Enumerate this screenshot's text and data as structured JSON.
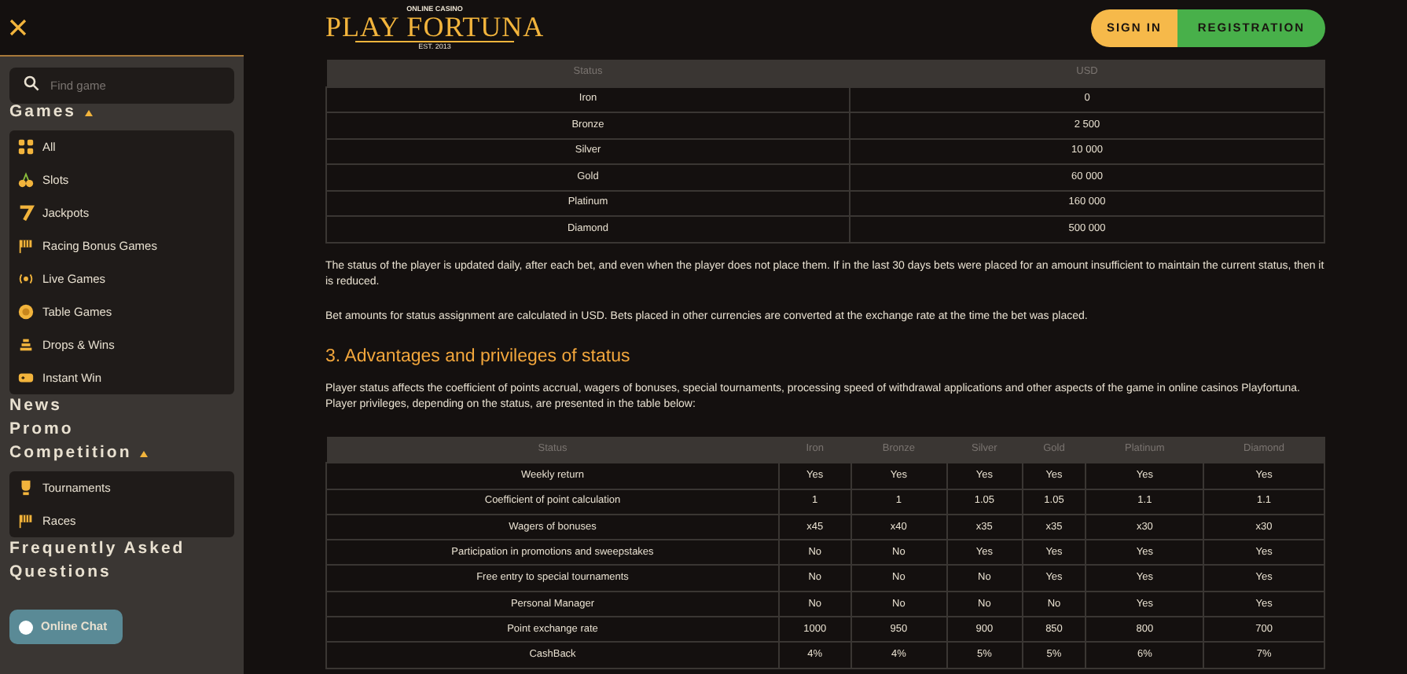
{
  "sidebar": {
    "search": {
      "placeholder": "Find game"
    },
    "sections": [
      {
        "label": "Games",
        "expanded": true,
        "items": [
          {
            "label": "All"
          },
          {
            "label": "Slots"
          },
          {
            "label": "Jackpots"
          },
          {
            "label": "Racing Bonus Games"
          },
          {
            "label": "Live Games"
          },
          {
            "label": "Table Games"
          },
          {
            "label": "Drops & Wins"
          },
          {
            "label": "Instant Win"
          }
        ]
      },
      {
        "label": "News"
      },
      {
        "label": "Promo"
      },
      {
        "label": "Competition",
        "expanded": true,
        "items": [
          {
            "label": "Tournaments"
          },
          {
            "label": "Races"
          }
        ]
      },
      {
        "label": "Frequently Asked Questions"
      }
    ],
    "chat_button": "Online Chat"
  },
  "header": {
    "logo": {
      "top": "ONLINE CASINO",
      "name": "PLAY FORTUNA",
      "bottom": "EST. 2013"
    },
    "buttons": [
      {
        "label": "SIGN IN",
        "kind": "signin"
      },
      {
        "label": "REGISTRATION",
        "kind": "register"
      }
    ]
  },
  "content": [
    {
      "kind": "table",
      "columns": [
        "Status",
        "USD"
      ],
      "rows": [
        [
          "Iron",
          "0"
        ],
        [
          "Bronze",
          "2 500"
        ],
        [
          "Silver",
          "10 000"
        ],
        [
          "Gold",
          "60 000"
        ],
        [
          "Platinum",
          "160 000"
        ],
        [
          "Diamond",
          "500 000"
        ]
      ]
    },
    {
      "kind": "paragraph",
      "text": "The status of the player is updated daily, after each bet, and even when the player does not place them. If in the last 30 days bets were placed for an amount insufficient to maintain the current status, then it is reduced."
    },
    {
      "kind": "paragraph",
      "text": "Bet amounts for status assignment are calculated in USD. Bets placed in other currencies are converted at the exchange rate at the time the bet was placed."
    },
    {
      "kind": "heading",
      "text": "3. Advantages and privileges of status"
    },
    {
      "kind": "paragraph",
      "text": "Player status affects the coefficient of points accrual, wagers of bonuses, special tournaments, processing speed of withdrawal applications and other aspects of the game in online casinos Playfortuna. Player privileges, depending on the status, are presented in the table below:"
    },
    {
      "kind": "table",
      "columns": [
        "Status",
        "Iron",
        "Bronze",
        "Silver",
        "Gold",
        "Platinum",
        "Diamond"
      ],
      "rows": [
        [
          "Weekly return",
          "Yes",
          "Yes",
          "Yes",
          "Yes",
          "Yes",
          "Yes"
        ],
        [
          "Coefficient of point calculation",
          "1",
          "1",
          "1.05",
          "1.05",
          "1.1",
          "1.1"
        ],
        [
          "Wagers of bonuses",
          "x45",
          "x40",
          "x35",
          "x35",
          "x30",
          "x30"
        ],
        [
          "Participation in promotions and sweepstakes",
          "No",
          "No",
          "Yes",
          "Yes",
          "Yes",
          "Yes"
        ],
        [
          "Free entry to special tournaments",
          "No",
          "No",
          "No",
          "Yes",
          "Yes",
          "Yes"
        ],
        [
          "Personal Manager",
          "No",
          "No",
          "No",
          "No",
          "Yes",
          "Yes"
        ],
        [
          "Point exchange rate",
          "1000",
          "950",
          "900",
          "850",
          "800",
          "700"
        ],
        [
          "CashBack",
          "4%",
          "4%",
          "5%",
          "5%",
          "6%",
          "7%"
        ]
      ]
    }
  ]
}
